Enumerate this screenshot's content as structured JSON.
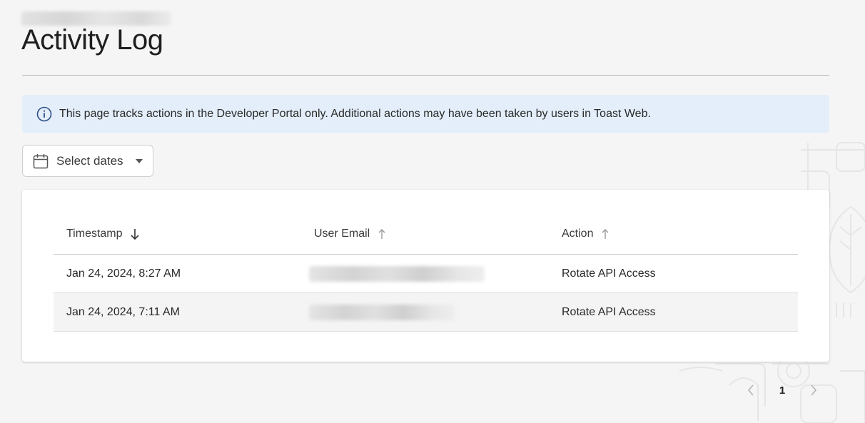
{
  "page": {
    "title": "Activity Log",
    "breadcrumb": "",
    "accent_color": "#2d63b3",
    "banner_bg": "#e3eefa"
  },
  "banner": {
    "icon": "info-icon",
    "text": "This page tracks actions in the Developer Portal only. Additional actions may have been taken by users in Toast Web."
  },
  "filter": {
    "icon": "calendar-icon",
    "label": "Select dates",
    "dropdown_icon": "caret-down-icon"
  },
  "table": {
    "columns": [
      {
        "label": "Timestamp",
        "sort": "descending",
        "sort_icon": "arrow-down-icon"
      },
      {
        "label": "User Email",
        "sort": "none",
        "sort_icon": "arrow-up-icon"
      },
      {
        "label": "Action",
        "sort": "none",
        "sort_icon": "arrow-up-icon"
      }
    ],
    "rows": [
      {
        "timestamp": "Jan 24, 2024, 8:27 AM",
        "email": "",
        "action": "Rotate API Access"
      },
      {
        "timestamp": "Jan 24, 2024, 7:11 AM",
        "email": "",
        "action": "Rotate API Access"
      }
    ]
  },
  "pagination": {
    "current_page": "1",
    "prev_icon": "chevron-left-icon",
    "next_icon": "chevron-right-icon"
  }
}
